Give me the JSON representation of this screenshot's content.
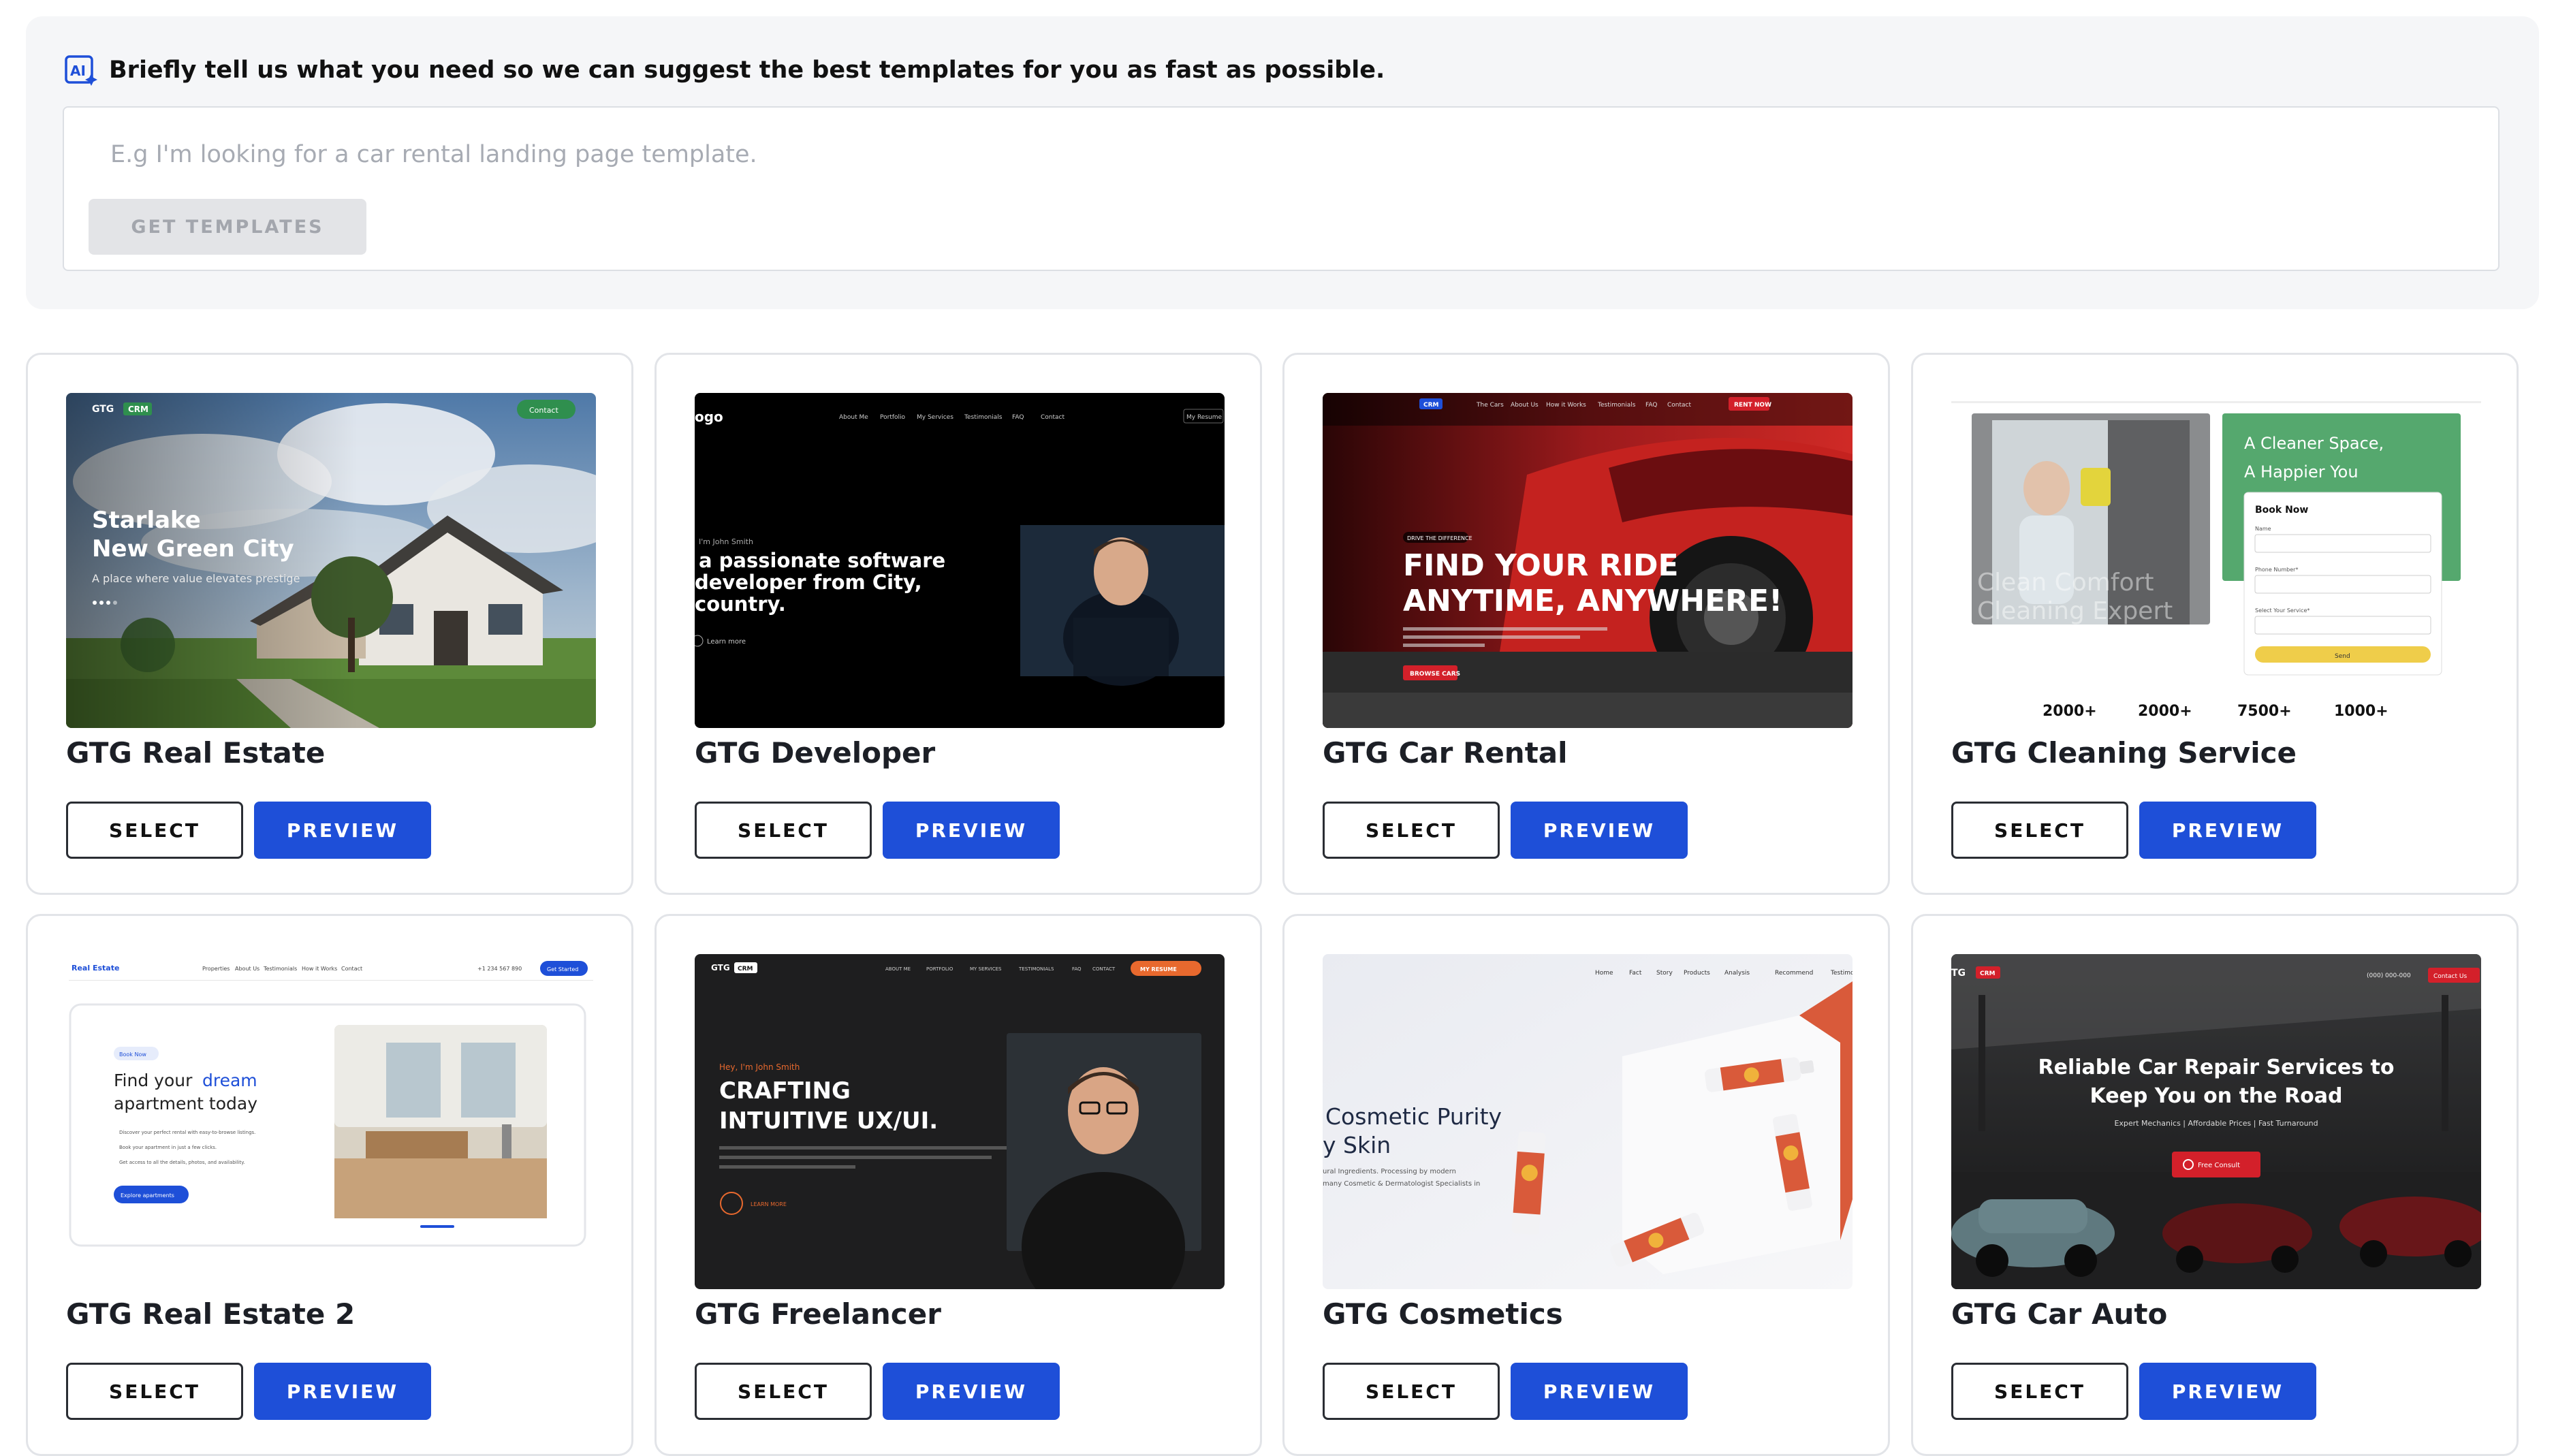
{
  "prompt": {
    "title": "Briefly tell us what you need so we can suggest the best templates for you as fast as possible.",
    "placeholder": "E.g I'm looking for a car rental landing page template.",
    "button_label": "GET TEMPLATES",
    "icon": "ai-sparkle-icon"
  },
  "buttons": {
    "select": "SELECT",
    "preview": "PREVIEW"
  },
  "templates": [
    {
      "name": "GTG Real Estate",
      "thumb": {
        "brand": "GTG",
        "badge": "CRM",
        "cta": "Contact",
        "headline1": "Starlake",
        "headline2": "New Green City",
        "sub": "A place where value elevates prestige"
      }
    },
    {
      "name": "GTG Developer",
      "thumb": {
        "logo": "ogo",
        "nav": [
          "About Me",
          "Portfolio",
          "My Services",
          "Testimonials",
          "FAQ",
          "Contact"
        ],
        "cta": "My Resume",
        "kicker": "I'm John Smith",
        "line1": "a passionate software",
        "line2": "developer from City,",
        "line3": "country.",
        "link": "Learn more"
      }
    },
    {
      "name": "GTG Car Rental",
      "thumb": {
        "badge": "CRM",
        "nav": [
          "The Cars",
          "About Us",
          "How it Works",
          "Testimonials",
          "FAQ",
          "Contact"
        ],
        "cta": "RENT NOW",
        "pill": "DRIVE THE DIFFERENCE",
        "line1": "FIND YOUR RIDE",
        "line2": "ANYTIME, ANYWHERE!",
        "button": "BROWSE CARS"
      }
    },
    {
      "name": "GTG Cleaning Service",
      "thumb": {
        "head1": "A Cleaner Space,",
        "head2": "A Happier You",
        "form_title": "Book Now",
        "f1": "Name",
        "f2": "Phone Number*",
        "f3": "Select Your Service*",
        "send": "Send",
        "overlay1": "Clean Comfort",
        "overlay2": "Cleaning Expert"
      },
      "stats": [
        "2000+",
        "2000+",
        "7500+",
        "1000+"
      ]
    },
    {
      "name": "GTG Real Estate 2",
      "thumb": {
        "logo": "Real Estate",
        "nav": [
          "Properties",
          "About Us",
          "Testimonials",
          "How it Works",
          "Contact"
        ],
        "phone": "+1 234 567 890",
        "cta": "Get Started",
        "chip": "Book Now",
        "h1": "Find your",
        "h1b": "dream",
        "h2": "apartment today",
        "bullets": [
          "Discover your perfect rental with easy-to-browse listings.",
          "Book your apartment in just a few clicks.",
          "Get access to all the details, photos, and availability."
        ],
        "button": "Explore apartments"
      }
    },
    {
      "name": "GTG Freelancer",
      "thumb": {
        "brand": "GTG",
        "badge": "CRM",
        "nav": [
          "ABOUT ME",
          "PORTFOLIO",
          "MY SERVICES",
          "TESTIMONIALS",
          "FAQ",
          "CONTACT"
        ],
        "cta": "MY RESUME",
        "kicker": "Hey, I'm John Smith",
        "line1": "CRAFTING",
        "line2": "INTUITIVE UX/UI.",
        "link": "LEARN MORE"
      }
    },
    {
      "name": "GTG Cosmetics",
      "thumb": {
        "nav": [
          "Home",
          "Fact",
          "Story",
          "Products",
          "Analysis",
          "Recommend",
          "Testimo"
        ],
        "line1": "Cosmetic Purity",
        "line2": "y Skin",
        "sub1": "ural Ingredients. Processing by modern",
        "sub2": "many Cosmetic & Dermatologist Specialists in"
      }
    },
    {
      "name": "GTG Car Auto",
      "thumb": {
        "brand": "TG",
        "badge": "CRM",
        "phone": "(000) 000-000",
        "cta": "Contact Us",
        "line1": "Reliable Car Repair Services to",
        "line2": "Keep You on the Road",
        "sub": "Expert Mechanics | Affordable Prices | Fast Turnaround",
        "button": "Free Consult"
      }
    }
  ],
  "colors": {
    "preview": "#1e4fd8",
    "cleaning_green": "#55a86e",
    "rental_red": "#d3202a",
    "freelancer_orange": "#e8692e"
  }
}
